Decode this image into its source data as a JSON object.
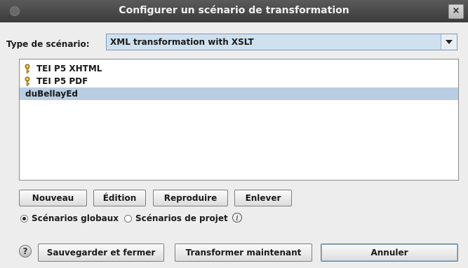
{
  "window": {
    "title": "Configurer un scénario de transformation",
    "close_label": "×"
  },
  "scenario_type": {
    "label": "Type de scénario:",
    "value": "XML transformation with XSLT"
  },
  "scenarios": [
    {
      "label": "TEI P5 XHTML",
      "icon": "key-icon",
      "selected": false
    },
    {
      "label": "TEI P5 PDF",
      "icon": "key-icon",
      "selected": false
    },
    {
      "label": "duBellayEd",
      "icon": "",
      "selected": true
    }
  ],
  "actions": {
    "new_label": "Nouveau",
    "edit_label": "Édition",
    "duplicate_label": "Reproduire",
    "remove_label": "Enlever"
  },
  "scope": {
    "global_label": "Scénarios globaux",
    "project_label": "Scénarios de projet",
    "selected": "global"
  },
  "footer": {
    "help_label": "?",
    "save_close_label": "Sauvegarder et fermer",
    "transform_now_label": "Transformer maintenant",
    "cancel_label": "Annuler"
  },
  "colors": {
    "selection": "#b9cee2",
    "titlebar": "#3b3b3b"
  }
}
